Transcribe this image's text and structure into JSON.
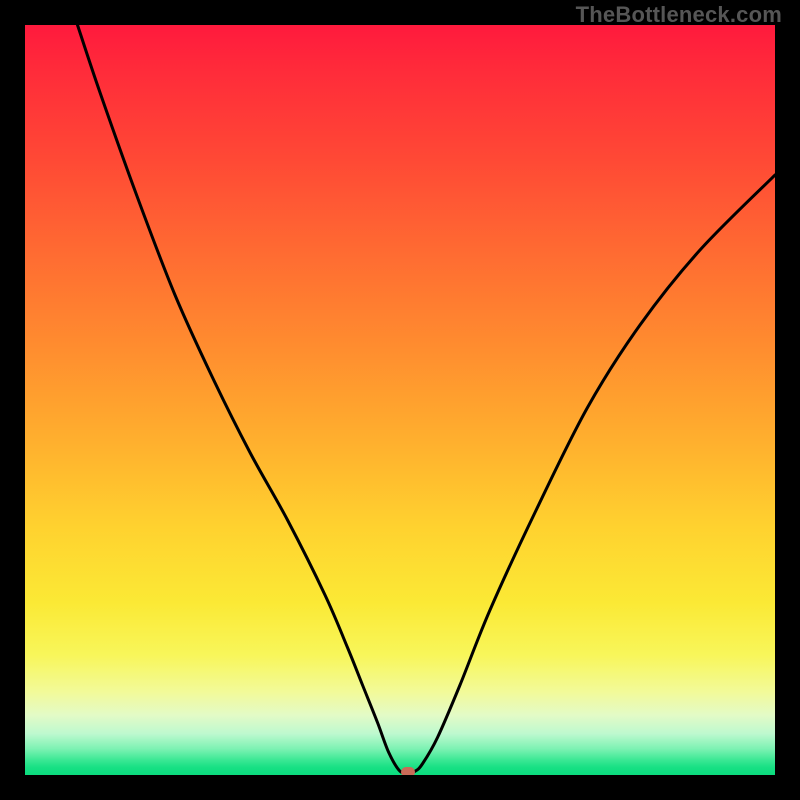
{
  "watermark": "TheBottleneck.com",
  "colors": {
    "curve": "#000000",
    "marker": "#c96a58"
  },
  "chart_data": {
    "type": "line",
    "title": "",
    "xlabel": "",
    "ylabel": "",
    "xlim": [
      0,
      100
    ],
    "ylim": [
      0,
      100
    ],
    "series": [
      {
        "name": "bottleneck-curve",
        "x": [
          7,
          10,
          15,
          20,
          25,
          30,
          35,
          40,
          43,
          45,
          47,
          48.5,
          50,
          51,
          52,
          53,
          55,
          58,
          62,
          68,
          75,
          82,
          90,
          100
        ],
        "y": [
          100,
          91,
          77,
          64,
          53,
          43,
          34,
          24,
          17,
          12,
          7,
          3,
          0.5,
          0.4,
          0.5,
          1.5,
          5,
          12,
          22,
          35,
          49,
          60,
          70,
          80
        ]
      }
    ],
    "marker": {
      "x": 51,
      "y": 0.4
    },
    "grid": false,
    "legend": false
  }
}
